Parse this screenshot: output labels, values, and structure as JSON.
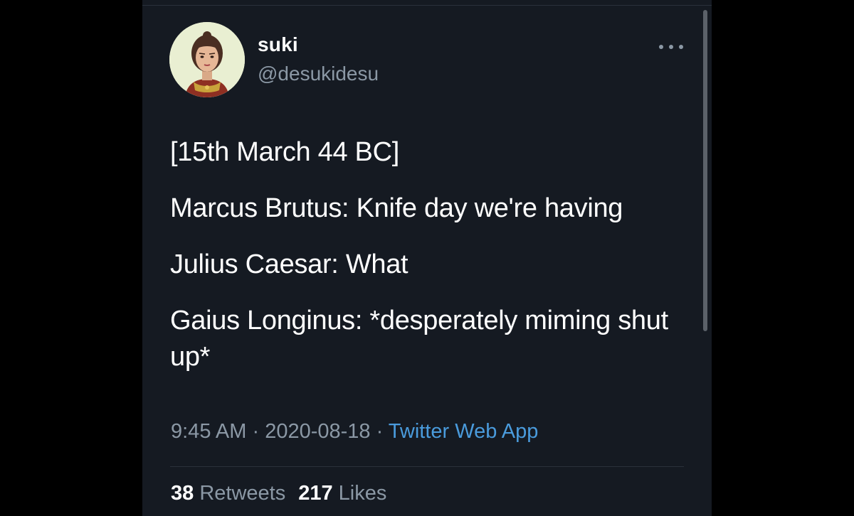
{
  "user": {
    "display_name": "suki",
    "handle": "@desukidesu"
  },
  "tweet": {
    "lines": [
      "[15th March 44 BC]",
      "Marcus Brutus: Knife day we're having",
      "Julius Caesar: What",
      "Gaius Longinus: *desperately miming shut up*"
    ]
  },
  "meta": {
    "time": "9:45 AM",
    "separator1": " · ",
    "date": "2020-08-18",
    "separator2": " · ",
    "source": "Twitter Web App"
  },
  "stats": {
    "retweets_count": "38",
    "retweets_label": "Retweets",
    "likes_count": "217",
    "likes_label": "Likes"
  },
  "icons": {
    "more": "more-options-icon",
    "avatar": "avatar"
  },
  "colors": {
    "background": "#151a22",
    "text": "#ffffff",
    "secondary_text": "#8b98a5",
    "link": "#4a9bdc"
  }
}
